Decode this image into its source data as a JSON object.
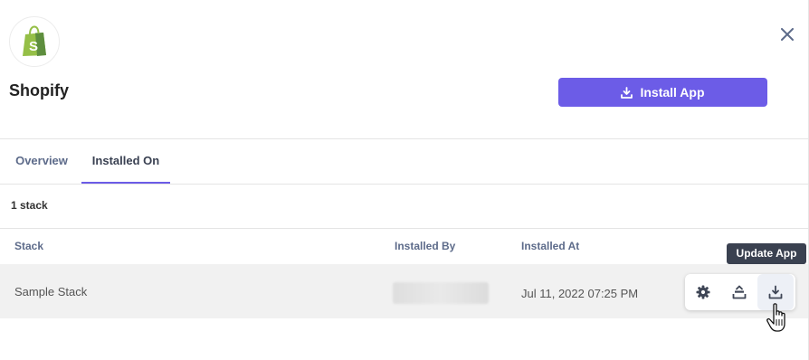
{
  "app": {
    "name": "Shopify",
    "logo_icon": "shopify-bag-icon",
    "brand_color": "#95bf47"
  },
  "header": {
    "install_label": "Install App",
    "install_color": "#6c5ce7",
    "close_icon": "close-icon"
  },
  "tabs": [
    {
      "label": "Overview",
      "active": false
    },
    {
      "label": "Installed On",
      "active": true
    }
  ],
  "stack_count": "1 stack",
  "table": {
    "columns": [
      "Stack",
      "Installed By",
      "Installed At"
    ],
    "rows": [
      {
        "stack": "Sample Stack",
        "installed_by": "",
        "installed_at": "Jul 11, 2022 07:25 PM"
      }
    ]
  },
  "row_actions": {
    "icons": [
      "gear-icon",
      "uninstall-icon",
      "update-icon"
    ],
    "tooltip": "Update App"
  }
}
